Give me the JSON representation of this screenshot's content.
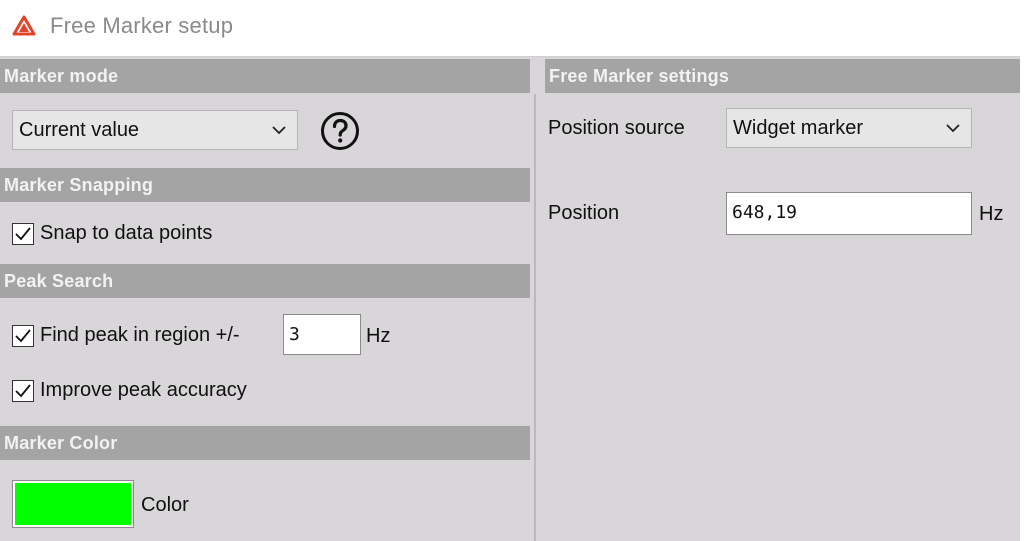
{
  "window": {
    "title": "Free Marker setup",
    "app_icon": "triangle-logo-icon",
    "accent_color": "#e0442a"
  },
  "left": {
    "marker_mode": {
      "header": "Marker mode",
      "dropdown_value": "Current value",
      "help_icon": "question-circle-icon"
    },
    "marker_snapping": {
      "header": "Marker Snapping",
      "snap_label": "Snap to data points",
      "snap_checked": true
    },
    "peak_search": {
      "header": "Peak Search",
      "find_peak_label": "Find peak in region +/-",
      "find_peak_checked": true,
      "region_value": "3",
      "region_unit": "Hz",
      "improve_label": "Improve peak accuracy",
      "improve_checked": true
    },
    "marker_color": {
      "header": "Marker Color",
      "color_value": "#00ff00",
      "color_label": "Color"
    }
  },
  "right": {
    "header": "Free Marker settings",
    "position_source_label": "Position source",
    "position_source_value": "Widget marker",
    "position_label": "Position",
    "position_value": "648,19",
    "position_unit": "Hz"
  }
}
